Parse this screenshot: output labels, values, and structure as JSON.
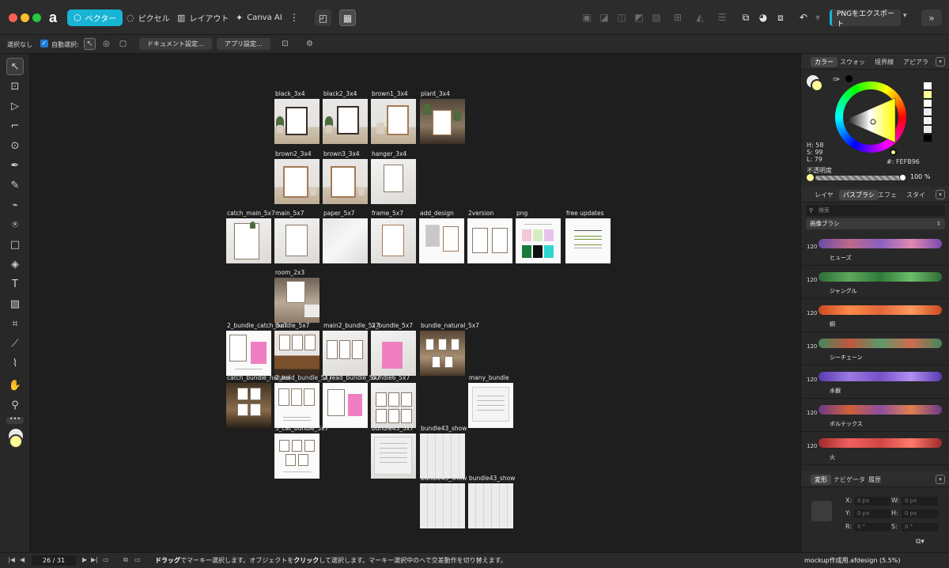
{
  "personas": [
    {
      "label": "ベクター",
      "icon": "vector-persona-icon",
      "active": true
    },
    {
      "label": "ピクセル",
      "icon": "pixel-persona-icon",
      "active": false
    },
    {
      "label": "レイアウト",
      "icon": "layout-persona-icon",
      "active": false
    },
    {
      "label": "Canva AI",
      "icon": "canva-ai-icon",
      "active": false
    }
  ],
  "export_label": "PNGをエクスポート",
  "context": {
    "selection": "選択なし",
    "auto_select_label": "自動選択:",
    "doc_settings": "ドキュメント設定...",
    "app_settings": "アプリ設定..."
  },
  "artboards": [
    {
      "label": "black_3x4"
    },
    {
      "label": "black2_3x4"
    },
    {
      "label": "brown1_3x4"
    },
    {
      "label": "plant_3x4"
    },
    {
      "label": "brown2_3x4"
    },
    {
      "label": "brown3_3x4"
    },
    {
      "label": "hanger_3x4"
    },
    {
      "label": "catch_main_5x7"
    },
    {
      "label": "main_5x7"
    },
    {
      "label": "paper_5x7"
    },
    {
      "label": "frame_5x7"
    },
    {
      "label": "add_design"
    },
    {
      "label": "2version"
    },
    {
      "label": "png"
    },
    {
      "label": "free updates"
    },
    {
      "label": "room_2x3"
    },
    {
      "label": "2_bundle_catch_5x7"
    },
    {
      "label": "bundle_5x7"
    },
    {
      "label": "main2_bundle_5x7"
    },
    {
      "label": "2_bundle_5x7"
    },
    {
      "label": "bundle_natural_5x7"
    },
    {
      "label": "catch_bundle_natural"
    },
    {
      "label": "2_lead_bundle_5x7"
    },
    {
      "label": "2_lead_bundle_5x7"
    },
    {
      "label": "bundle6_5x7"
    },
    {
      "label": "many_bundle"
    },
    {
      "label": "3_cat_bundle_5x7"
    },
    {
      "label": "bundle43_5x7"
    },
    {
      "label": "bundle43_show"
    },
    {
      "label": "bundle43_show"
    },
    {
      "label": "bundle43_show"
    }
  ],
  "right_panel": {
    "color_tabs": [
      "カラー",
      "スウォッ",
      "境界線",
      "アピアラ"
    ],
    "hsl": {
      "h": "H: 58",
      "s": "S: 99",
      "l": "L: 79"
    },
    "hex": "#: FEFB96",
    "opacity_label": "不透明度",
    "opacity_value": "100 %",
    "layer_tabs": [
      "レイヤ",
      "パスブラシ",
      "エフェ",
      "スタイ"
    ],
    "search_placeholder": "検索",
    "brush_category": "画像ブラシ",
    "brushes": [
      {
        "size": "120",
        "name": "ヒューズ",
        "color": "#8a5fc0"
      },
      {
        "size": "120",
        "name": "ジャングル",
        "color": "#3f8c4a"
      },
      {
        "size": "120",
        "name": "銅",
        "color": "#e2673a"
      },
      {
        "size": "120",
        "name": "シーチェーン",
        "color": "#b5553f"
      },
      {
        "size": "120",
        "name": "水銀",
        "color": "#7750c9"
      },
      {
        "size": "120",
        "name": "ボルテックス",
        "color": "#8d4f9e"
      },
      {
        "size": "120",
        "name": "火",
        "color": "#d24545"
      }
    ],
    "transform_tabs": [
      "変形",
      "ナビゲータ",
      "履歴"
    ],
    "transform": {
      "x_label": "X:",
      "x": "0 px",
      "y_label": "Y:",
      "y": "0 px",
      "w_label": "W:",
      "w": "0 px",
      "h_label": "H:",
      "h": "0 px",
      "r_label": "R:",
      "r": "0 °",
      "s_label": "S:",
      "s": "0 °"
    }
  },
  "status": {
    "page": "26 / 31",
    "message_1": "ドラッグ",
    "message_2": "でマーキー選択します。オブジェクトを",
    "message_3": "クリック",
    "message_4": "して選択します。マーキー選択中の",
    "message_5": "へで交差動作を切り替えます。",
    "doc_name": "mockup作成用.afdesign (5.5%)"
  },
  "colors": {
    "accent": "#18b4d6",
    "fg_color": "#fefb96"
  }
}
